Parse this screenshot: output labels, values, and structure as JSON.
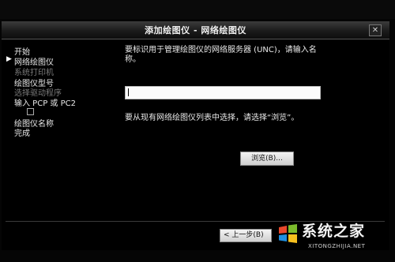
{
  "window": {
    "title": "添加绘图仪 - 网络绘图仪",
    "close_label": "✕"
  },
  "steps": [
    {
      "label": "开始",
      "state": "done"
    },
    {
      "label": "网络绘图仪",
      "state": "current"
    },
    {
      "label": "系统打印机",
      "state": "disabled"
    },
    {
      "label": "绘图仪型号",
      "state": "done"
    },
    {
      "label": "选择驱动程序",
      "state": "disabled"
    },
    {
      "label": "输入 PCP 或 PC2",
      "state": "done"
    },
    {
      "label": "绘图仪名称",
      "state": "done"
    },
    {
      "label": "完成",
      "state": "done"
    }
  ],
  "main": {
    "prompt": "要标识用于管理绘图仪的网络服务器 (UNC)，请输入名称。",
    "name_value": "",
    "browse_hint": "要从现有网络绘图仪列表中选择，请选择“浏览”。",
    "browse_label": "浏览(B)..."
  },
  "footer": {
    "back_label": "< 上一步(B)"
  },
  "watermark": {
    "text": "系统之家",
    "url": "XITONGZHIJIA.NET"
  },
  "colors": {
    "background": "#000000",
    "text": "#eaeaea",
    "disabled_text": "#7a7a7a"
  }
}
